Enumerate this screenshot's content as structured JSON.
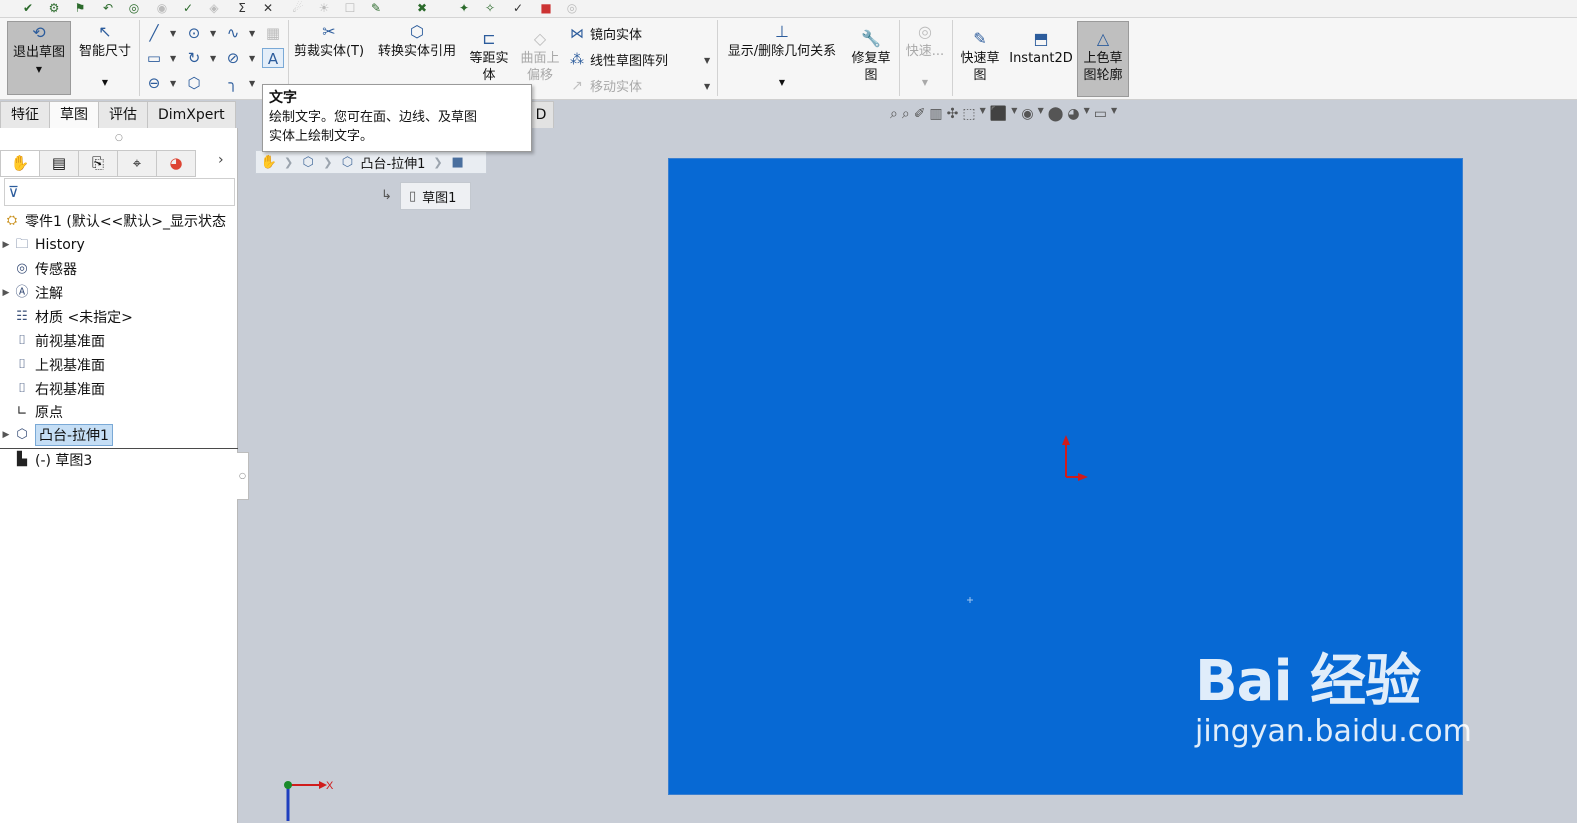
{
  "ribbon": {
    "exit_sketch": "退出草图",
    "smart_dim": "智能尺寸",
    "trim": "剪裁实体(T)",
    "convert": "转换实体引用",
    "offset_l1": "等距实",
    "offset_l2": "体",
    "surface_l1": "曲面上",
    "surface_l2": "偏移",
    "mirror": "镜向实体",
    "linear_pattern": "线性草图阵列",
    "move": "移动实体",
    "relations": "显示/删除几何关系",
    "repair_l1": "修复草",
    "repair_l2": "图",
    "quick_dis": "快速...",
    "quick_sketch_l1": "快速草",
    "quick_sketch_l2": "图",
    "instant2d": "Instant2D",
    "shaded_l1": "上色草",
    "shaded_l2": "图轮廓"
  },
  "tabs": [
    "特征",
    "草图",
    "评估",
    "DimXpert"
  ],
  "tab_d": "D",
  "tooltip": {
    "title": "文字",
    "line1": "绘制文字。您可在面、边线、及草图",
    "line2": "实体上绘制文字。"
  },
  "tree": {
    "root": "零件1  (默认<<默认>_显示状态",
    "items": [
      {
        "label": "History",
        "icon": "history-icon"
      },
      {
        "label": "传感器",
        "icon": "sensor-icon"
      },
      {
        "label": "注解",
        "icon": "annotation-icon"
      },
      {
        "label": "材质 <未指定>",
        "icon": "material-icon"
      },
      {
        "label": "前视基准面",
        "icon": "plane-icon"
      },
      {
        "label": "上视基准面",
        "icon": "plane-icon"
      },
      {
        "label": "右视基准面",
        "icon": "plane-icon"
      },
      {
        "label": "原点",
        "icon": "origin-icon"
      },
      {
        "label": "凸台-拉伸1",
        "icon": "extrude-icon"
      },
      {
        "label": "(-) 草图3",
        "icon": "sketch-icon"
      }
    ]
  },
  "crumb": {
    "feature": "凸台-拉伸1",
    "sketch": "草图1"
  },
  "triad": {
    "x_label": "X"
  },
  "watermark": {
    "main": "Bai 经验",
    "sub": "jingyan.baidu.com"
  },
  "colors": {
    "canvas": "#0769d4",
    "origin_red": "#d01c1c",
    "accent": "#2c5c9c"
  }
}
